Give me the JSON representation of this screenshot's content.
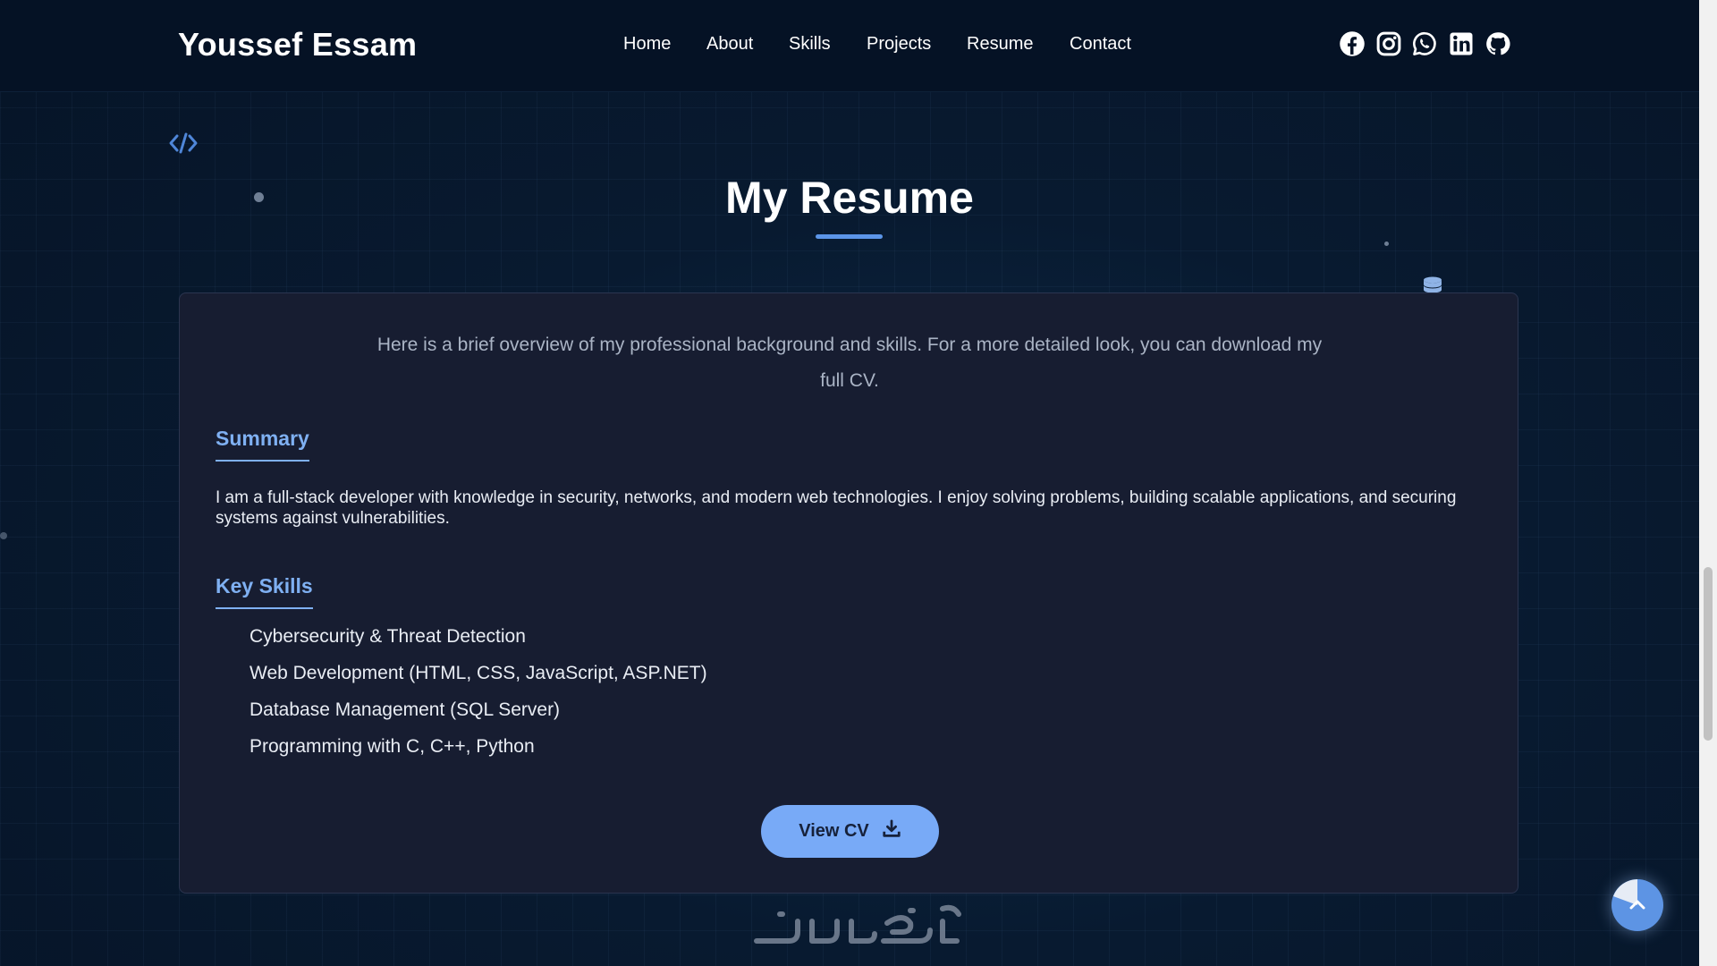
{
  "header": {
    "brand": "Youssef Essam",
    "nav": [
      {
        "label": "Home"
      },
      {
        "label": "About"
      },
      {
        "label": "Skills"
      },
      {
        "label": "Projects"
      },
      {
        "label": "Resume"
      },
      {
        "label": "Contact"
      }
    ],
    "socials": [
      "facebook-icon",
      "instagram-icon",
      "whatsapp-icon",
      "linkedin-icon",
      "github-icon"
    ]
  },
  "section": {
    "title": "My Resume"
  },
  "resume": {
    "intro": "Here is a brief overview of my professional background and skills. For a more detailed look, you can download my full CV.",
    "summary_heading": "Summary",
    "summary_text": "I am a full-stack developer with knowledge in security, networks, and modern web technologies. I enjoy solving problems, building scalable applications, and securing systems against vulnerabilities.",
    "skills_heading": "Key Skills",
    "skills": [
      "Cybersecurity & Threat Detection",
      "Web Development (HTML, CSS, JavaScript, ASP.NET)",
      "Database Management (SQL Server)",
      "Programming with C, C++, Python"
    ],
    "cv_button": "View CV"
  },
  "colors": {
    "accent": "#78aaf7",
    "heading_accent": "#7fb0f2",
    "card_bg": "#171d31",
    "nav_bg": "#051225"
  }
}
